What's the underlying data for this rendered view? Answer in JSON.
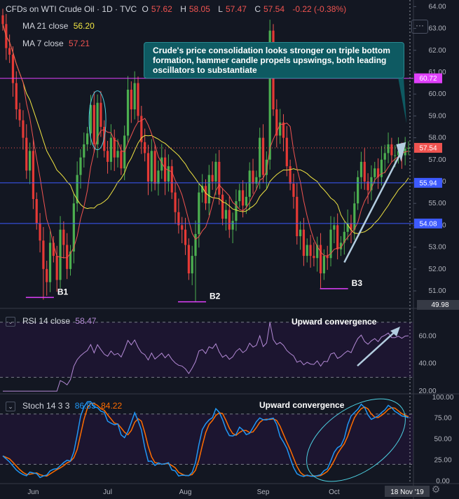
{
  "header": {
    "symbol": "CFDs on WTI Crude Oil · 1D · TVC",
    "open_label": "O",
    "open": "57.62",
    "high_label": "H",
    "high": "58.05",
    "low_label": "L",
    "low": "57.47",
    "close_label": "C",
    "close": "57.54",
    "change": "-0.22 (-0.38%)"
  },
  "ma21": {
    "label": "MA 21 close",
    "value": "56.20",
    "color": "#f0e442"
  },
  "ma7": {
    "label": "MA 7 close",
    "value": "57.21",
    "color": "#ef5350"
  },
  "callout": "Crude's price consolidation looks stronger on triple bottom formation, hammer candle propels upswings, both leading oscillators to substantiate",
  "rsi": {
    "label": "RSI 14 close",
    "value": "58.47",
    "color": "#b48ad6",
    "annotation": "Upward convergence"
  },
  "stoch": {
    "label": "Stoch 14 3 3",
    "k": "86.85",
    "d": "84.22",
    "k_color": "#2196f3",
    "d_color": "#ff6d00",
    "annotation": "Upward convergence"
  },
  "chart_data": [
    {
      "type": "candlestick",
      "title": "CFDs on WTI Crude Oil · 1D · TVC",
      "x_ticks": [
        "Jun",
        "Jul",
        "Aug",
        "Sep",
        "Oct",
        "Nov"
      ],
      "cursor_date": "18 Nov '19",
      "y_ticks": [
        51.0,
        52.0,
        53.0,
        54.0,
        55.0,
        56.0,
        57.0,
        58.0,
        59.0,
        60.0,
        61.0,
        62.0,
        63.0,
        64.0
      ],
      "ylim": [
        50.2,
        64.3
      ],
      "horizontal_levels": [
        {
          "value": 60.72,
          "label": "60.72",
          "color": "#e040fb"
        },
        {
          "value": 55.94,
          "label": "55.94",
          "color": "#3d5afe"
        },
        {
          "value": 54.08,
          "label": "54.08",
          "color": "#3d5afe"
        },
        {
          "value": 49.98,
          "label": "49.98",
          "color": "#787b86"
        }
      ],
      "last_price": {
        "value": 57.54,
        "label": "57.54",
        "color": "#ef5350"
      },
      "bottom_labels": [
        {
          "label": "B1",
          "date_index": 12,
          "price": 50.7
        },
        {
          "label": "B2",
          "date_index": 57,
          "price": 50.5
        },
        {
          "label": "B3",
          "date_index": 99,
          "price": 51.1
        }
      ],
      "closes": [
        63.2,
        62.1,
        61.8,
        60.5,
        59.3,
        58.8,
        58.0,
        56.5,
        57.4,
        55.2,
        54.1,
        53.3,
        52.0,
        51.4,
        53.2,
        52.6,
        51.5,
        53.8,
        53.1,
        52.0,
        52.8,
        55.0,
        56.3,
        57.1,
        57.7,
        58.2,
        59.5,
        57.7,
        59.6,
        58.5,
        57.4,
        56.9,
        58.0,
        57.1,
        57.4,
        56.6,
        58.1,
        60.2,
        59.3,
        60.5,
        59.0,
        57.8,
        57.3,
        56.0,
        57.4,
        55.9,
        56.5,
        57.1,
        56.0,
        56.7,
        55.5,
        54.6,
        54.0,
        53.8,
        53.1,
        51.8,
        52.6,
        53.6,
        55.5,
        55.8,
        55.0,
        56.3,
        56.0,
        56.9,
        55.4,
        54.3,
        54.7,
        53.8,
        54.2,
        55.1,
        55.6,
        54.9,
        55.3,
        56.5,
        55.9,
        56.2,
        58.0,
        56.3,
        57.0,
        62.9,
        59.3,
        58.1,
        58.7,
        58.0,
        56.7,
        55.9,
        55.3,
        53.5,
        53.8,
        52.6,
        53.1,
        52.6,
        52.5,
        53.1,
        51.8,
        52.6,
        52.5,
        53.8,
        54.0,
        52.9,
        53.2,
        53.7,
        54.1,
        53.8,
        55.0,
        56.2,
        56.9,
        56.0,
        55.6,
        56.2,
        56.6,
        56.2,
        57.0,
        57.3,
        57.7,
        57.2,
        57.2,
        57.4,
        57.2,
        57.5,
        57.54
      ],
      "ma21_close_last": 56.2,
      "ma7_close_last": 57.21
    },
    {
      "type": "line",
      "title": "RSI 14 close",
      "y_ticks": [
        20.0,
        40.0,
        60.0
      ],
      "ylim": [
        18,
        78
      ],
      "bands": [
        30,
        70
      ],
      "last_value": 58.47,
      "trend_arrow": true
    },
    {
      "type": "line",
      "title": "Stoch 14 3 3",
      "series": [
        {
          "name": "%K",
          "last": 86.85
        },
        {
          "name": "%D",
          "last": 84.22
        }
      ],
      "y_ticks": [
        0.0,
        25.0,
        50.0,
        75.0,
        100.0
      ],
      "ylim": [
        -3,
        104
      ],
      "bands": [
        20,
        80
      ],
      "highlight_ellipse": true
    }
  ]
}
